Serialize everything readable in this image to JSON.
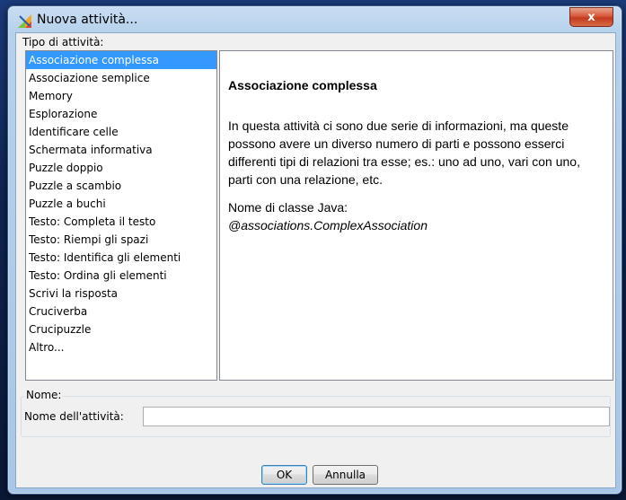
{
  "window": {
    "title": "Nuova attività...",
    "close_label": "x"
  },
  "activity_type": {
    "group_label": "Tipo di attività:",
    "items": [
      "Associazione complessa",
      "Associazione semplice",
      "Memory",
      "Esplorazione",
      "Identificare celle",
      "Schermata informativa",
      "Puzzle doppio",
      "Puzzle a scambio",
      "Puzzle a buchi",
      "Testo: Completa il testo",
      "Testo: Riempi gli spazi",
      "Testo: Identifica gli elementi",
      "Testo: Ordina gli elementi",
      "Scrivi la risposta",
      "Cruciverba",
      "Crucipuzzle",
      "Altro..."
    ],
    "selected_index": 0
  },
  "description": {
    "title": "Associazione complessa",
    "body": "In questa attività ci sono due serie di informazioni, ma queste possono avere un diverso numero di parti e possono esserci differenti tipi di relazioni tra esse; es.: uno ad uno, vari con uno, parti con una relazione, etc.",
    "class_label": "Nome di classe Java:",
    "class_value": "@associations.ComplexAssociation"
  },
  "name_section": {
    "group_label": "Nome:",
    "field_label": "Nome dell'attività:",
    "field_value": ""
  },
  "buttons": {
    "ok": "OK",
    "cancel": "Annulla"
  },
  "colors": {
    "selection": "#3399ff",
    "title_bar": "#b6d1ec",
    "close_button": "#c23a1c"
  }
}
